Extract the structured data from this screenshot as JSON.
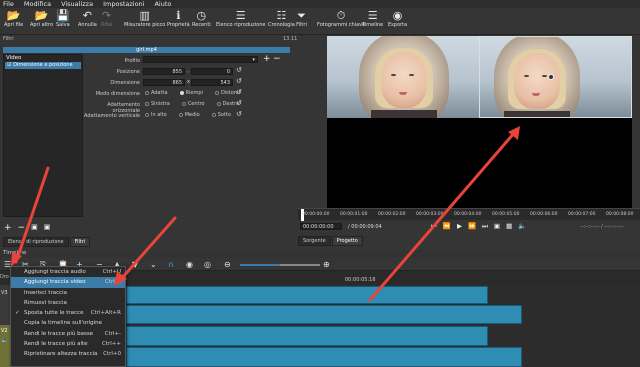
{
  "menubar": [
    "File",
    "Modifica",
    "Visualizza",
    "Impostazioni",
    "Aiuto"
  ],
  "toolbar": [
    {
      "label": "Apri file",
      "icon": "folder-icon",
      "glyph": "📂"
    },
    {
      "label": "Apri altro",
      "icon": "folder-more-icon",
      "glyph": "📂"
    },
    {
      "label": "Salva",
      "icon": "save-icon",
      "glyph": "💾"
    },
    {
      "label": "Annulla",
      "icon": "undo-icon",
      "glyph": "↶"
    },
    {
      "label": "Rifai",
      "icon": "redo-icon",
      "glyph": "↷",
      "disabled": true
    },
    {
      "label": "Misuratore picco",
      "icon": "peak-meter-icon",
      "glyph": "▥"
    },
    {
      "label": "Proprietà",
      "icon": "info-icon",
      "glyph": "ℹ"
    },
    {
      "label": "Recenti",
      "icon": "clock-icon",
      "glyph": "◷"
    },
    {
      "label": "Elenco riproduzione",
      "icon": "playlist-icon",
      "glyph": "☰"
    },
    {
      "label": "Cronologia",
      "icon": "history-icon",
      "glyph": "☷"
    },
    {
      "label": "Filtri",
      "icon": "filter-icon",
      "glyph": "⏷"
    },
    {
      "label": "Fotogrammi chiave",
      "icon": "stopwatch-icon",
      "glyph": "⏱"
    },
    {
      "label": "Timeline",
      "icon": "timeline-icon",
      "glyph": "☰"
    },
    {
      "label": "Esporta",
      "icon": "export-icon",
      "glyph": "◉"
    }
  ],
  "filters": {
    "header": "Filtri",
    "header_right": "13.11",
    "clip_name": "girl.mp4",
    "category": "Video",
    "selected_filter": "Dimensione e posizione",
    "profile_label": "Profilo",
    "position_label": "Posizione",
    "position_x": "855",
    "position_y": "0",
    "size_label": "Dimensione",
    "size_w": "865",
    "size_h": "543",
    "mode_label": "Modo dimensione",
    "mode_options": [
      "Adatta",
      "Riempi",
      "Distorci"
    ],
    "halign_label": "Adattamento orizzontale",
    "halign_options": [
      "Sinistra",
      "Centro",
      "Destra"
    ],
    "valign_label": "Adattamento verticale",
    "valign_options": [
      "In alto",
      "Medio",
      "Sotto"
    ]
  },
  "left_tabs": [
    "Elenco di riproduzione",
    "Filtri"
  ],
  "preview": {
    "ruler": [
      "00:00:00:00",
      "00:00:01:00",
      "00:00:02:00",
      "00:00:03:00",
      "00:00:04:00",
      "00:00:05:00",
      "00:00:06:00",
      "00:00:07:00",
      "00:00:08:00"
    ],
    "timecode": "00:00:00:00",
    "duration": "/ 00:00:09:04",
    "inout": "--:--:--:-- / --:--:--:--",
    "tabs": [
      "Sorgente",
      "Progetto"
    ]
  },
  "timeline": {
    "header": "Timeline",
    "ruler_mark": "00:00:05:16",
    "track_labels": [
      "Dro",
      "V3",
      "V2"
    ],
    "v2_label": "V2"
  },
  "context_menu": [
    {
      "label": "Aggiungi traccia audio",
      "shortcut": "Ctrl+U"
    },
    {
      "label": "Aggiungi traccia video",
      "shortcut": "Ctrl+I",
      "highlighted": true
    },
    {
      "label": "Inserisci traccia",
      "shortcut": ""
    },
    {
      "label": "Rimuovi traccia",
      "shortcut": ""
    },
    {
      "label": "Sposta tutte le tracce",
      "shortcut": "Ctrl+Alt+R",
      "checked": true
    },
    {
      "label": "Copia la timeline sull'origine",
      "shortcut": ""
    },
    {
      "label": "Rendi le tracce più basse",
      "shortcut": "Ctrl+-"
    },
    {
      "label": "Rendi le tracce più alte",
      "shortcut": "Ctrl++"
    },
    {
      "label": "Ripristinare altezza traccia",
      "shortcut": "Ctrl+0"
    }
  ],
  "colors": {
    "accent": "#3c7ca8",
    "arrow": "#e8443a",
    "clip": "#2f8cb3"
  }
}
